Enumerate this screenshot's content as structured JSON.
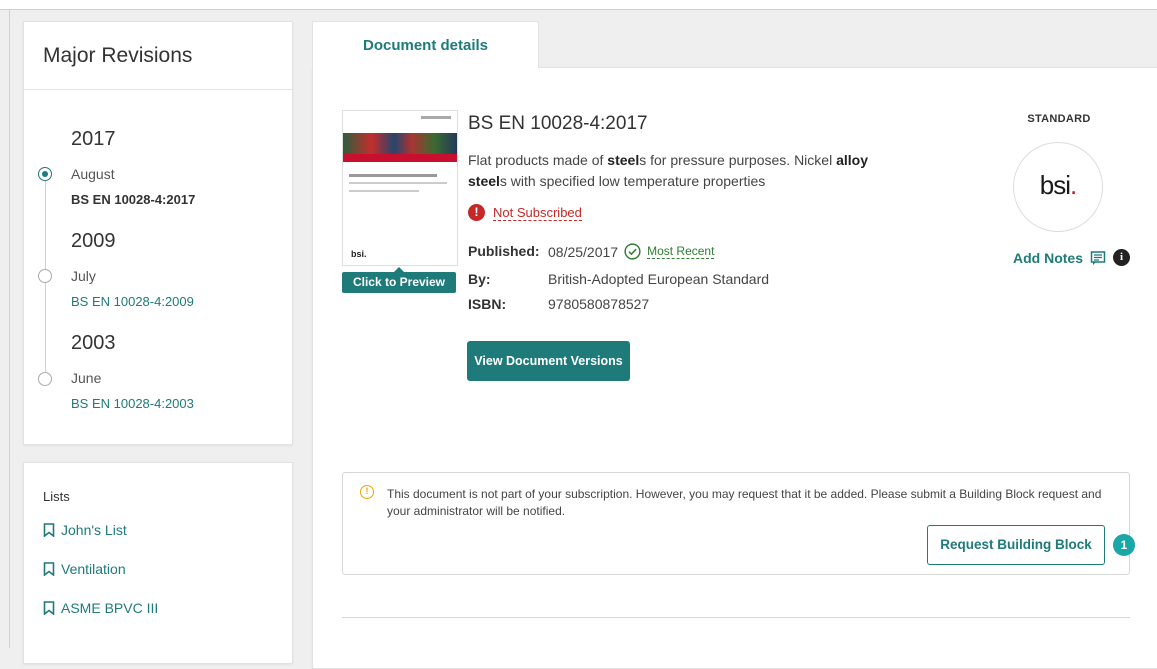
{
  "revisions": {
    "title": "Major Revisions",
    "entries": [
      {
        "year": "2017",
        "month": "August",
        "code": "BS EN 10028-4:2017",
        "selected": true
      },
      {
        "year": "2009",
        "month": "July",
        "code": "BS EN 10028-4:2009",
        "selected": false
      },
      {
        "year": "2003",
        "month": "June",
        "code": "BS EN 10028-4:2003",
        "selected": false
      }
    ]
  },
  "lists": {
    "title": "Lists",
    "items": [
      "John's List",
      "Ventilation",
      "ASME BPVC III"
    ]
  },
  "tab": {
    "label": "Document details"
  },
  "document": {
    "preview_label": "Click to Preview",
    "title": "BS EN 10028-4:2017",
    "description_parts": {
      "p1": "Flat products made of ",
      "b1": "steel",
      "p2": "s for pressure purposes. Nickel ",
      "b2": "alloy",
      "b3": "steel",
      "p3": "s with specified low temperature properties"
    },
    "subscription_status": "Not Subscribed",
    "published_label": "Published:",
    "published_value": "08/25/2017",
    "most_recent_label": "Most Recent",
    "by_label": "By:",
    "by_value": "British-Adopted European Standard",
    "isbn_label": "ISBN:",
    "isbn_value": "9780580878527",
    "versions_button": "View Document Versions",
    "type_label": "STANDARD",
    "publisher_logo": "bsi",
    "add_notes_label": "Add Notes",
    "cover_logo": "bsi."
  },
  "notice": {
    "text": "This document is not part of your subscription. However, you may request that it be added. Please submit a Building Block request and your administrator will be notified.",
    "button_label": "Request Building Block",
    "badge": "1"
  },
  "colors": {
    "accent": "#1f7a7a",
    "error": "#c62828",
    "warning": "#f0a500",
    "badge": "#19a7a7"
  }
}
